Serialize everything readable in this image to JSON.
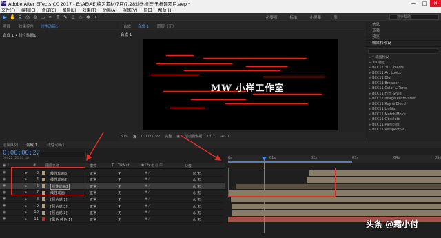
{
  "window": {
    "title": "Adobe After Effects CC 2017 - E:\\AE\\AE\\练习素材\\7月\\7.28动效标识\\无标题项目.aep *",
    "app_badge": "Ae",
    "controls": [
      "—",
      "□",
      "✕"
    ]
  },
  "menu": [
    "文件(F)",
    "编辑(E)",
    "合成(C)",
    "图层(L)",
    "效果(T)",
    "动画(A)",
    "视图(V)",
    "窗口",
    "帮助(H)"
  ],
  "workspaces": [
    "必要项",
    "标准",
    "小屏幕",
    "库"
  ],
  "search_help_placeholder": "搜索帮助",
  "project_panel": {
    "tabs": [
      "项目",
      "效果控件",
      "线性动画1"
    ],
    "breadcrumb": "合成 1 • 线性动画1"
  },
  "composition_panel": {
    "tabs": [
      "合成",
      "合成 1"
    ],
    "layer_tab": "图层（无）",
    "crumb": "合成 1",
    "logo_text": "MW 小样工作室",
    "viewer_bar": [
      "50%",
      "0:00:00:22",
      "完整",
      "活动摄像机",
      "1个...",
      "+0.0"
    ]
  },
  "right_panel": {
    "sections": [
      "信息",
      "音频",
      "预览",
      "效果和预设"
    ],
    "search_placeholder": "",
    "effects": [
      "* 动画预设",
      "3D 通道",
      "BCC11 3D Objects",
      "BCC11 Art Looks",
      "BCC11 Blur",
      "BCC11 Browser",
      "BCC11 Color & Tone",
      "BCC11 Film Style",
      "BCC11 Image Restoration",
      "BCC11 Key & Blend",
      "BCC11 Lights",
      "BCC11 Match Move",
      "BCC11 Obsolete",
      "BCC11 Particles",
      "BCC11 Perspective"
    ]
  },
  "timeline": {
    "tabs": [
      "渲染队列",
      "合成 1",
      "线性动画1"
    ],
    "timecode": "0:00:00:22",
    "frames": "00022 (25.00 fps)",
    "columns": {
      "num": "#",
      "name": "图层名称",
      "mode": "模式",
      "t": "T",
      "trkmat": "TrkMat",
      "parent": "父级"
    },
    "ruler_ticks": [
      "0s",
      "01s",
      "02s",
      "03s",
      "04s",
      "05s"
    ],
    "layers": [
      {
        "num": "3",
        "name": "线性动画3",
        "mode": "正常",
        "trkmat": "无",
        "parent": "无",
        "color": "#b5a27c"
      },
      {
        "num": "4",
        "name": "线性动画2",
        "mode": "正常",
        "trkmat": "无",
        "parent": "无",
        "color": "#b5a27c"
      },
      {
        "num": "6",
        "name": "线性动画1",
        "mode": "正常",
        "trkmat": "无",
        "parent": "无",
        "color": "#b5a27c"
      },
      {
        "num": "7",
        "name": "线性动画",
        "mode": "正常",
        "trkmat": "无",
        "parent": "无",
        "color": "#b5a27c"
      },
      {
        "num": "8",
        "name": "[预合成 1]",
        "mode": "正常",
        "trkmat": "无",
        "parent": "无",
        "color": "#b5a27c"
      },
      {
        "num": "9",
        "name": "[预合成 3]",
        "mode": "正常",
        "trkmat": "无",
        "parent": "无",
        "color": "#b5a27c"
      },
      {
        "num": "10",
        "name": "[预合成 2]",
        "mode": "正常",
        "trkmat": "无",
        "parent": "无",
        "color": "#b5a27c"
      },
      {
        "num": "11",
        "name": "[黑色 纯色 1]",
        "mode": "正常",
        "trkmat": "无",
        "parent": "无",
        "color": "#c02a2a"
      }
    ]
  },
  "watermark": "头条 @霜小付"
}
